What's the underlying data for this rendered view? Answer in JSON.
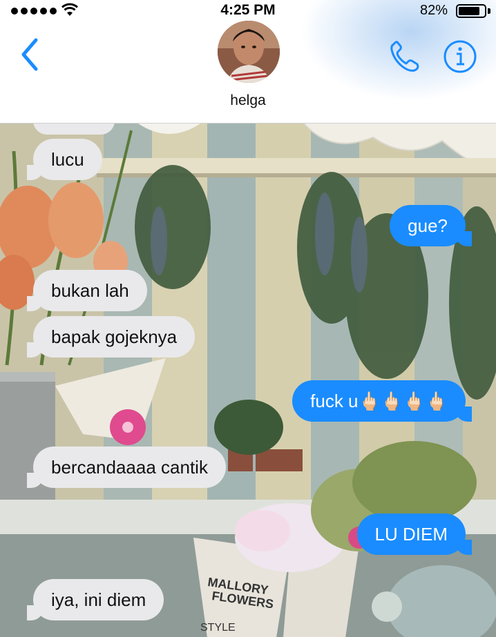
{
  "status_bar": {
    "time": "4:25 PM",
    "battery_percent": "82%",
    "battery_level": 0.82,
    "signal_dots": 5
  },
  "header": {
    "contact_name": "helga",
    "back_icon": "chevron-left-icon",
    "call_icon": "phone-icon",
    "info_icon": "info-icon"
  },
  "colors": {
    "accent": "#1a8cff",
    "incoming_bubble": "#e9e9eb",
    "outgoing_bubble": "#1a8cff"
  },
  "messages": [
    {
      "direction": "incoming",
      "text": "lucu"
    },
    {
      "direction": "outgoing",
      "text": "gue?"
    },
    {
      "direction": "incoming",
      "text": "bukan lah"
    },
    {
      "direction": "incoming",
      "text": "bapak gojeknya"
    },
    {
      "direction": "outgoing",
      "text": "fuck u🖕🏻🖕🏻🖕🏻🖕🏻"
    },
    {
      "direction": "incoming",
      "text": "bercandaaaa cantik"
    },
    {
      "direction": "outgoing",
      "text": "LU DIEM"
    },
    {
      "direction": "incoming",
      "text": "iya, ini diem"
    }
  ],
  "wallpaper_text": {
    "brand_line1": "MALLORY",
    "brand_line2": "FLOWERS",
    "brand_style": "STYLE"
  }
}
